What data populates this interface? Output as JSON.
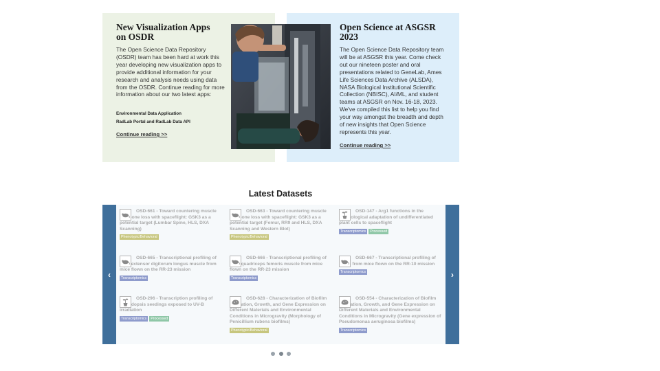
{
  "news": [
    {
      "title": "New Visualization Apps on OSDR",
      "body": "The Open Science Data Repository (OSDR) team has been hard at work this year developing new visualization apps to provide additional information for your research and analysis needs using data from the OSDR. Continue reading for more information about our two latest apps:",
      "links": [
        "Environmental Data Application",
        "RadLab Portal and RadLab Data API"
      ],
      "more": "Continue reading >>"
    },
    {
      "title": "Open Science at ASGSR 2023",
      "body": "The Open Science Data Repository team will be at ASGSR this year. Come check out our nineteen poster and oral presentations related to GeneLab, Ames Life Sciences Data Archive (ALSDA), NASA Biological Institutional Scientific Collection (NBISC), AI/ML, and student teams at ASGSR on Nov. 16-18, 2023. We've compiled this list to help you find your way amongst the breadth and depth of new insights that Open Science represents this year.",
      "more": "Continue reading >>"
    }
  ],
  "datasets_heading": "Latest Datasets",
  "carousel": {
    "prev": "‹",
    "next": "›",
    "pages": 3,
    "active_page": 2
  },
  "datasets": [
    {
      "title": "OSD-661 - Toward countering muscle and bone loss with spaceflight: GSK3 as a potential target (Lumbar Spine, HLS, DXA Scanning)",
      "icon": "mouse-icon",
      "tags": [
        "Phenotypic/Behavioral"
      ]
    },
    {
      "title": "OSD-663 - Toward countering muscle and bone loss with spaceflight: GSK3 as a potential target (Femur, RR9 and HLS, DXA Scanning and Western Blot)",
      "icon": "mouse-icon",
      "tags": [
        "Phenotypic/Behavioral"
      ]
    },
    {
      "title": "OSD-147 - Arg1 functions in the physiological adaptation of undifferentiated plant cells to spaceflight",
      "icon": "plant-icon",
      "tags": [
        "Transcriptomics",
        "Processed"
      ]
    },
    {
      "title": "OSD-665 - Transcriptional profiling of right extensor digitorum longus muscle from mice flown on the RR-23 mission",
      "icon": "mouse-icon",
      "tags": [
        "Transcriptomics"
      ]
    },
    {
      "title": "OSD-666 - Transcriptional profiling of right quadriceps femoris muscle from mice flown on the RR-23 mission",
      "icon": "mouse-icon",
      "tags": [
        "Transcriptomics"
      ]
    },
    {
      "title": "OSD-667 - Transcriptional profiling of colon from mice flown on the RR-10 mission",
      "icon": "mouse-icon",
      "tags": [
        "Transcriptomics"
      ]
    },
    {
      "title": "OSD-296 - Transcription profiling of Arabidopsis seedings exposed to UV-B irradiation",
      "icon": "plant-icon",
      "tags": [
        "Transcriptomics",
        "Processed"
      ]
    },
    {
      "title": "OSD-628 - Characterization of Biofilm Formation, Growth, and Gene Expression on Different Materials and Environmental Conditions in Microgravity (Morphology of Penicillium rubens biofilms)",
      "icon": "microbe-icon",
      "tags": [
        "Phenotypic/Behavioral"
      ]
    },
    {
      "title": "OSD-554 - Characterization of Biofilm Formation, Growth, and Gene Expression on Different Materials and Environmental Conditions in Microgravity (Gene expression of Pseudomonas aeruginosa biofilms)",
      "icon": "microbe-icon",
      "tags": [
        "Transcriptomics"
      ]
    }
  ],
  "colors": {
    "green_card": "#ecf2e5",
    "blue_card": "#ddeefa",
    "carousel_button": "#3f6f9b",
    "tag_phenotypic": "#c7c67e",
    "tag_transcriptomics": "#8e9bcc",
    "tag_processed": "#8fc7a7"
  }
}
